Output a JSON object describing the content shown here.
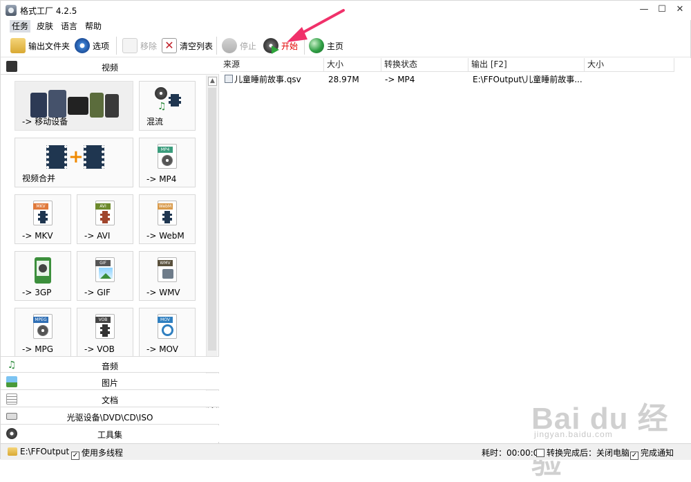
{
  "window": {
    "title": "格式工厂 4.2.5",
    "minimize": "—",
    "maximize": "☐",
    "close": "✕"
  },
  "menu": [
    "任务",
    "皮肤",
    "语言",
    "帮助"
  ],
  "toolbar": {
    "output_folder": "输出文件夹",
    "options": "选项",
    "remove": "移除",
    "clear_list": "清空列表",
    "stop": "停止",
    "start": "开始",
    "home": "主页"
  },
  "categories": {
    "video": "视频",
    "audio": "音频",
    "picture": "图片",
    "document": "文档",
    "rom": "光驱设备\\DVD\\CD\\ISO",
    "tools": "工具集"
  },
  "tiles": {
    "mobile": "-> 移动设备",
    "mux": "混流",
    "merge": "视频合并",
    "mp4": "-> MP4",
    "mkv": "-> MKV",
    "avi": "-> AVI",
    "webm": "-> WebM",
    "3gp": "-> 3GP",
    "gif": "-> GIF",
    "wmv": "-> WMV",
    "mpg": "-> MPG",
    "vob": "-> VOB",
    "mov": "-> MOV"
  },
  "badges": {
    "mp4": "MP4",
    "mkv": "MKV",
    "avi": "AVI",
    "webm": "WebM",
    "gif": "GIF",
    "wmv": "WMV",
    "mpg": "MPEG",
    "vob": "VOB",
    "mov": "MOV",
    "3gp": "3GP"
  },
  "list": {
    "headers": [
      "来源",
      "大小",
      "转换状态",
      "输出 [F2]",
      "大小"
    ],
    "rows": [
      {
        "source": "儿童睡前故事.qsv",
        "size": "28.97M",
        "status": "-> MP4",
        "output": "E:\\FFOutput\\儿童睡前故事...",
        "out_size": ""
      }
    ]
  },
  "status": {
    "output_path": "E:\\FFOutput",
    "multithread": "使用多线程",
    "elapsed": "耗时：00:00:00",
    "after_done": "转换完成后：关闭电脑",
    "notify": "完成通知"
  },
  "watermark": {
    "logo": "Bai du 经验",
    "url": "jingyan.baidu.com"
  }
}
